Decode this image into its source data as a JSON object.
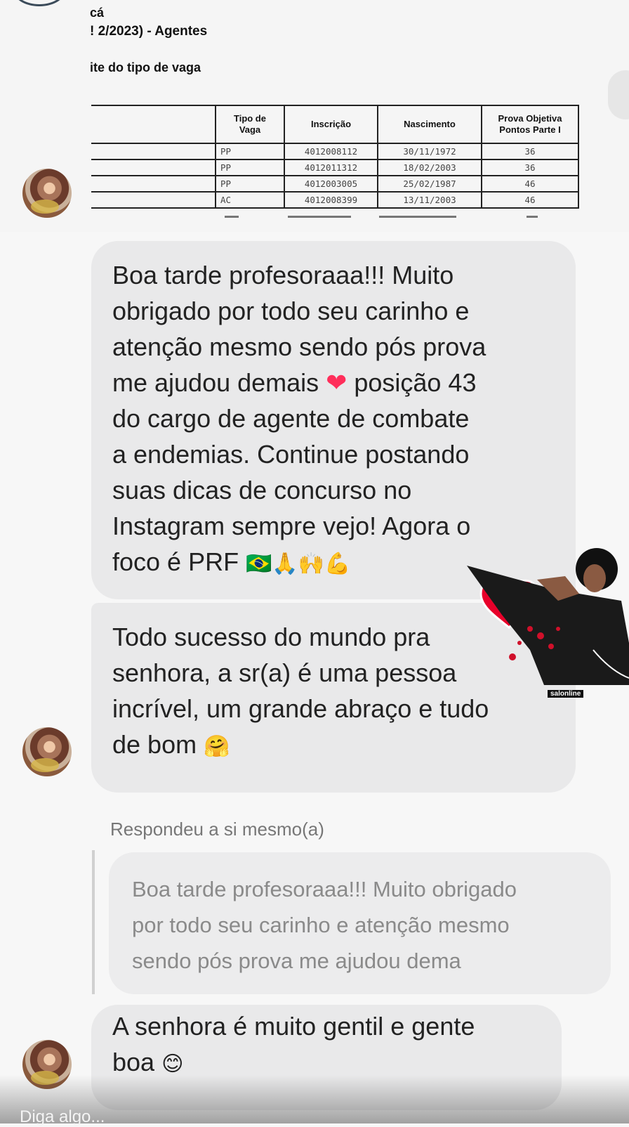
{
  "document": {
    "line1": "cá",
    "line2": "! 2/2023) - Agentes",
    "line3": "ite do tipo de vaga",
    "table": {
      "headers": [
        "Tipo de\nVaga",
        "Inscrição",
        "Nascimento",
        "Prova Objetiva\nPontos Parte I"
      ],
      "rows": [
        [
          "PP",
          "4012008112",
          "30/11/1972",
          "36"
        ],
        [
          "PP",
          "4012011312",
          "18/02/2003",
          "36"
        ],
        [
          "PP",
          "4012003005",
          "25/02/1987",
          "46"
        ],
        [
          "AC",
          "4012008399",
          "13/11/2003",
          "46"
        ]
      ]
    }
  },
  "messages": {
    "m1_part1": "Boa tarde profesoraaa!!! Muito\nobrigado por todo seu carinho e\natenção mesmo sendo pós prova\nme ajudou demais ",
    "m1_heart": "❤",
    "m1_part2": " posição 43\ndo cargo de agente de combate\na endemias. Continue postando\nsuas dicas de concurso no\nInstagram sempre vejo! Agora o\nfoco é PRF ",
    "m1_emojis": "🇧🇷🙏🙌💪",
    "m2_text": "Todo sucesso do mundo pra\nsenhora, a sr(a) é uma pessoa\nincrível, um grande abraço e tudo\nde bom ",
    "m2_emoji": "🤗",
    "reply_label": "Respondeu a si mesmo(a)",
    "quoted_text": "Boa tarde profesoraaa!!! Muito obrigado\npor todo seu carinho e atenção mesmo\nsendo pós prova me ajudou dema",
    "m3_text": "A senhora é muito gentil e gente\nboa ",
    "m3_emoji": "😊"
  },
  "sticker": {
    "tag": "salonline"
  },
  "composer": {
    "placeholder": "Diga algo..."
  },
  "colors": {
    "bubble": "#e9e9ea",
    "heart": "#ff2e5a",
    "background": "#f7f7f7"
  }
}
